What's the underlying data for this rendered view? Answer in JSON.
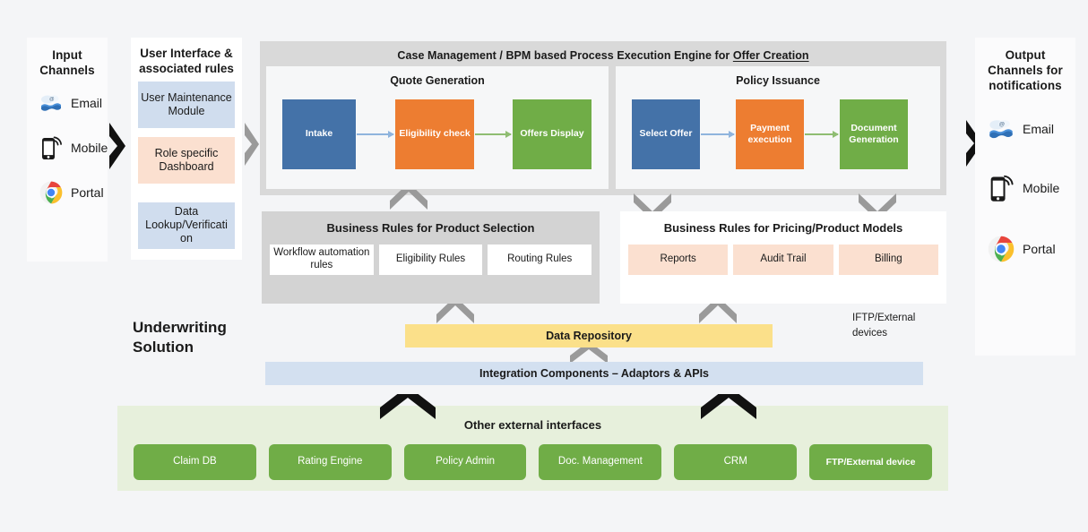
{
  "diagram": {
    "solution_label": "Underwriting\nSolution",
    "note_iftp": "IFTP/External\ndevices"
  },
  "input_channels": {
    "title": "Input\nChannels",
    "items": [
      {
        "label": "Email",
        "icon": "email-icon"
      },
      {
        "label": "Mobile",
        "icon": "mobile-phone-icon"
      },
      {
        "label": "Portal",
        "icon": "chrome-browser-icon"
      }
    ]
  },
  "output_channels": {
    "title": "Output\nChannels for\nnotifications",
    "items": [
      {
        "label": "Email",
        "icon": "email-icon"
      },
      {
        "label": "Mobile",
        "icon": "mobile-phone-icon"
      },
      {
        "label": "Portal",
        "icon": "chrome-browser-icon"
      }
    ]
  },
  "user_interface": {
    "title": "User Interface &\nassociated rules",
    "modules": [
      {
        "label": "User Maintenance Module",
        "color": "#d0ddee"
      },
      {
        "label": "Role specific Dashboard",
        "color": "#fbe0d0"
      },
      {
        "label": "Data Lookup/Verificati on",
        "color": "#d0ddee"
      }
    ]
  },
  "engine": {
    "title_prefix": "Case Management / BPM based Process Execution Engine for ",
    "title_underlined": "Offer Creation",
    "subprocesses": [
      {
        "title": "Quote Generation",
        "steps": [
          {
            "label": "Intake",
            "color": "#4472a8"
          },
          {
            "label": "Eligibility check",
            "color": "#ed7d31"
          },
          {
            "label": "Offers Display",
            "color": "#70ad47"
          }
        ]
      },
      {
        "title": "Policy Issuance",
        "steps": [
          {
            "label": "Select Offer",
            "color": "#4472a8"
          },
          {
            "label": "Payment execution",
            "color": "#ed7d31"
          },
          {
            "label": "Document Generation",
            "color": "#70ad47"
          }
        ]
      }
    ]
  },
  "business_rules": [
    {
      "title": "Business Rules for Product Selection",
      "panel_color": "#d3d3d3",
      "chip_color": "#ffffff",
      "chips": [
        "Workflow automation rules",
        "Eligibility Rules",
        "Routing Rules"
      ]
    },
    {
      "title": "Business Rules for Pricing/Product Models",
      "panel_color": "#ffffff",
      "chip_color": "#fbe0d0",
      "chips": [
        "Reports",
        "Audit Trail",
        "Billing"
      ]
    }
  ],
  "data_repository": {
    "label": "Data Repository",
    "color": "#fbe08a"
  },
  "integration": {
    "label": "Integration Components – Adaptors & APIs",
    "color": "#d3e0f0"
  },
  "external_interfaces": {
    "title": "Other external interfaces",
    "items": [
      "Claim DB",
      "Rating Engine",
      "Policy Admin",
      "Doc. Management",
      "CRM",
      "FTP/External device"
    ]
  },
  "colors": {
    "blue": "#4472a8",
    "orange": "#ed7d31",
    "green": "#70ad47",
    "light_blue": "#d0ddee",
    "peach": "#fbe0d0",
    "yellow": "#fbe08a",
    "gray_panel": "#d9d9d9",
    "ext_bg": "#e7f0dc",
    "background": "#f4f5f7"
  }
}
